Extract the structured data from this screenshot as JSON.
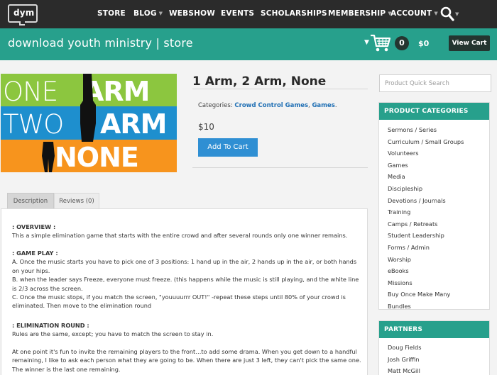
{
  "nav": {
    "logo_text": "dym",
    "items": [
      {
        "label": "STORE",
        "caret": false
      },
      {
        "label": "BLOG",
        "caret": true
      },
      {
        "label": "WEBSHOW",
        "caret": false
      },
      {
        "label": "EVENTS",
        "caret": false
      },
      {
        "label": "SCHOLARSHIPS",
        "caret": false
      },
      {
        "label": "MEMBERSHIP",
        "caret": true
      },
      {
        "label": "ACCOUNT",
        "caret": true
      }
    ],
    "search_icon": "search-icon"
  },
  "header": {
    "store_title": "download youth ministry | store",
    "cart_count": "0",
    "cart_total": "$0",
    "view_cart_label": "View Cart"
  },
  "product_image": {
    "line1": [
      "ONE",
      "ARM"
    ],
    "line2": [
      "TWO",
      "ARM"
    ],
    "line3": "NONE",
    "colors": {
      "green": "#8cc63f",
      "blue": "#1e8fce",
      "orange": "#f7941d"
    }
  },
  "product": {
    "title": "1 Arm, 2 Arm, None",
    "categories_label": "Categories:",
    "categories": [
      "Crowd Control Games",
      "Games"
    ],
    "price": "$10",
    "add_to_cart_label": "Add To Cart"
  },
  "tabs": [
    {
      "label": "Description",
      "active": true
    },
    {
      "label": "Reviews (0)",
      "active": false
    }
  ],
  "description": {
    "overview_heading": ": OVERVIEW :",
    "overview_text": "This a simple elimination game that starts with the entire crowd and after several rounds only one winner remains.",
    "gameplay_heading": ": GAME PLAY :",
    "gameplay_a": "A. Once the music starts you have to pick one of 3 positions: 1 hand up in the air, 2 hands up in the air, or both hands on your hips.",
    "gameplay_b": "B. when the leader says Freeze, everyone must freeze. (this happens while the music is still playing, and the white line is 2/3 across the screen.",
    "gameplay_c": "C. Once the music stops, if you match the screen, \"youuuurrr OUT!\" -repeat these steps until 80% of your crowd is eliminated. Then move to the elimination round",
    "elimination_heading": ": ELIMINATION ROUND :",
    "elimination_text": "Rules are the same, except; you have to match the screen to stay in.",
    "final_text": "At one point it's fun to invite the remaining players to the front…to add some drama. When you get down to a handful remaining, I like to ask each person what they are going to be.  When there are just 3 left, they can't pick the same one. The winner is the last one remaining."
  },
  "sidebar": {
    "search_placeholder": "Product Quick Search",
    "categories_heading": "PRODUCT CATEGORIES",
    "categories": [
      "Sermons / Series",
      "Curriculum / Small Groups",
      "Volunteers",
      "Games",
      "Media",
      "Discipleship",
      "Devotions / Journals",
      "Training",
      "Camps / Retreats",
      "Student Leadership",
      "Forms / Admin",
      "Worship",
      "eBooks",
      "Missions",
      "Buy Once Make Many",
      "Bundles"
    ],
    "partners_heading": "PARTNERS",
    "partners": [
      "Doug Fields",
      "Josh Griffin",
      "Matt McGill"
    ]
  },
  "colors": {
    "nav_bg": "#2b2b2b",
    "brand_green": "#27a08c",
    "dark_button": "#243530",
    "add_to_cart_blue": "#2f8fd3",
    "link_blue": "#1f6fb4"
  }
}
